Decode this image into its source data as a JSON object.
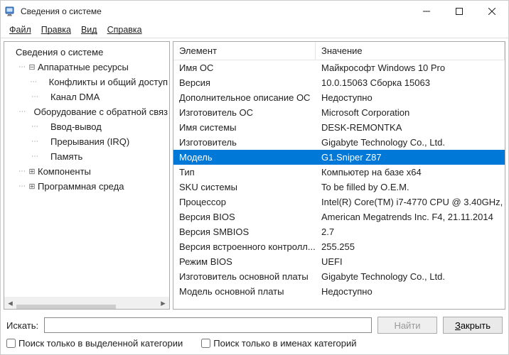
{
  "title": "Сведения о системе",
  "menu": [
    "Файл",
    "Правка",
    "Вид",
    "Справка"
  ],
  "tree": [
    {
      "level": 0,
      "toggle": "",
      "label": "Сведения о системе"
    },
    {
      "level": 1,
      "toggle": "⊟",
      "label": "Аппаратные ресурсы"
    },
    {
      "level": 2,
      "toggle": "",
      "label": "Конфликты и общий доступ"
    },
    {
      "level": 2,
      "toggle": "",
      "label": "Канал DMA"
    },
    {
      "level": 2,
      "toggle": "",
      "label": "Оборудование с обратной связ"
    },
    {
      "level": 2,
      "toggle": "",
      "label": "Ввод-вывод"
    },
    {
      "level": 2,
      "toggle": "",
      "label": "Прерывания (IRQ)"
    },
    {
      "level": 2,
      "toggle": "",
      "label": "Память"
    },
    {
      "level": 1,
      "toggle": "⊞",
      "label": "Компоненты"
    },
    {
      "level": 1,
      "toggle": "⊞",
      "label": "Программная среда"
    }
  ],
  "table": {
    "headers": [
      "Элемент",
      "Значение"
    ],
    "rows": [
      {
        "k": "Имя ОС",
        "v": "Майкрософт Windows 10 Pro"
      },
      {
        "k": "Версия",
        "v": "10.0.15063 Сборка 15063"
      },
      {
        "k": "Дополнительное описание ОС",
        "v": "Недоступно"
      },
      {
        "k": "Изготовитель ОС",
        "v": "Microsoft Corporation"
      },
      {
        "k": "Имя системы",
        "v": "DESK-REMONTKA"
      },
      {
        "k": "Изготовитель",
        "v": "Gigabyte Technology Co., Ltd."
      },
      {
        "k": "Модель",
        "v": "G1.Sniper Z87",
        "selected": true
      },
      {
        "k": "Тип",
        "v": "Компьютер на базе x64"
      },
      {
        "k": "SKU системы",
        "v": "To be filled by O.E.M."
      },
      {
        "k": "Процессор",
        "v": "Intel(R) Core(TM) i7-4770 CPU @ 3.40GHz,"
      },
      {
        "k": "Версия BIOS",
        "v": "American Megatrends Inc. F4, 21.11.2014"
      },
      {
        "k": "Версия SMBIOS",
        "v": "2.7"
      },
      {
        "k": "Версия встроенного контролл...",
        "v": "255.255"
      },
      {
        "k": "Режим BIOS",
        "v": "UEFI"
      },
      {
        "k": "Изготовитель основной платы",
        "v": "Gigabyte Technology Co., Ltd."
      },
      {
        "k": "Модель основной платы",
        "v": "Недоступно"
      }
    ]
  },
  "footer": {
    "search_label": "Искать:",
    "find_button": "Найти",
    "close_button": "Закрыть",
    "chk1": "Поиск только в выделенной категории",
    "chk2": "Поиск только в именах категорий"
  }
}
